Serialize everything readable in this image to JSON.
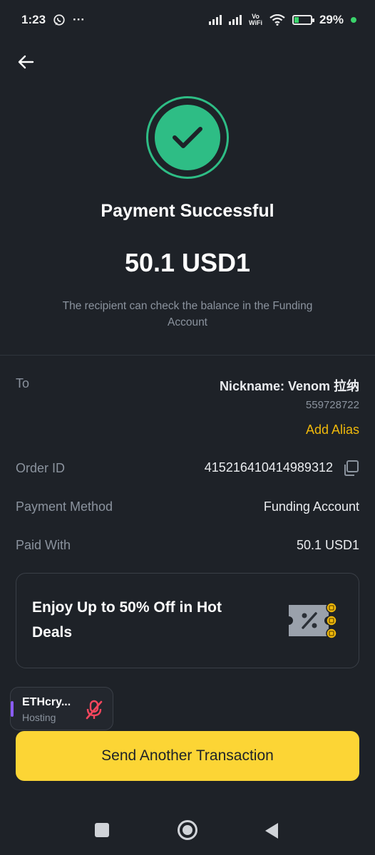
{
  "status_bar": {
    "time": "1:23",
    "whatsapp_icon": "whatsapp-icon",
    "more_indicator": "···",
    "vowifi_line1": "Vo",
    "vowifi_line2": "WiFi",
    "battery_percent": "29%",
    "battery_level": 0.29
  },
  "header": {
    "back_icon": "arrow-left-icon"
  },
  "result": {
    "icon": "check-circle-icon",
    "title": "Payment Successful",
    "amount": "50.1 USD1",
    "note": "The recipient can check the balance in the Funding Account"
  },
  "details": {
    "to_label": "To",
    "nickname": "Nickname: Venom 拉纳",
    "uid": "559728722",
    "add_alias": "Add Alias",
    "order_id_label": "Order ID",
    "order_id": "415216410414989312",
    "payment_method_label": "Payment Method",
    "payment_method": "Funding Account",
    "paid_with_label": "Paid With",
    "paid_with": "50.1 USD1"
  },
  "promo": {
    "text": "Enjoy Up to 50% Off in Hot Deals",
    "icon": "coupon-icon"
  },
  "floating_bubble": {
    "name": "ETHcry...",
    "subtitle": "Hosting",
    "icon": "mic-muted-icon"
  },
  "cta": {
    "label": "Send Another Transaction"
  },
  "nav_bar": {
    "recents_icon": "square-icon",
    "home_icon": "circle-icon",
    "back_icon": "triangle-back-icon"
  },
  "colors": {
    "background": "#1e2228",
    "success": "#2ebd85",
    "accent": "#f0b90b",
    "button": "#fcd535",
    "muted_text": "#8b939e"
  }
}
